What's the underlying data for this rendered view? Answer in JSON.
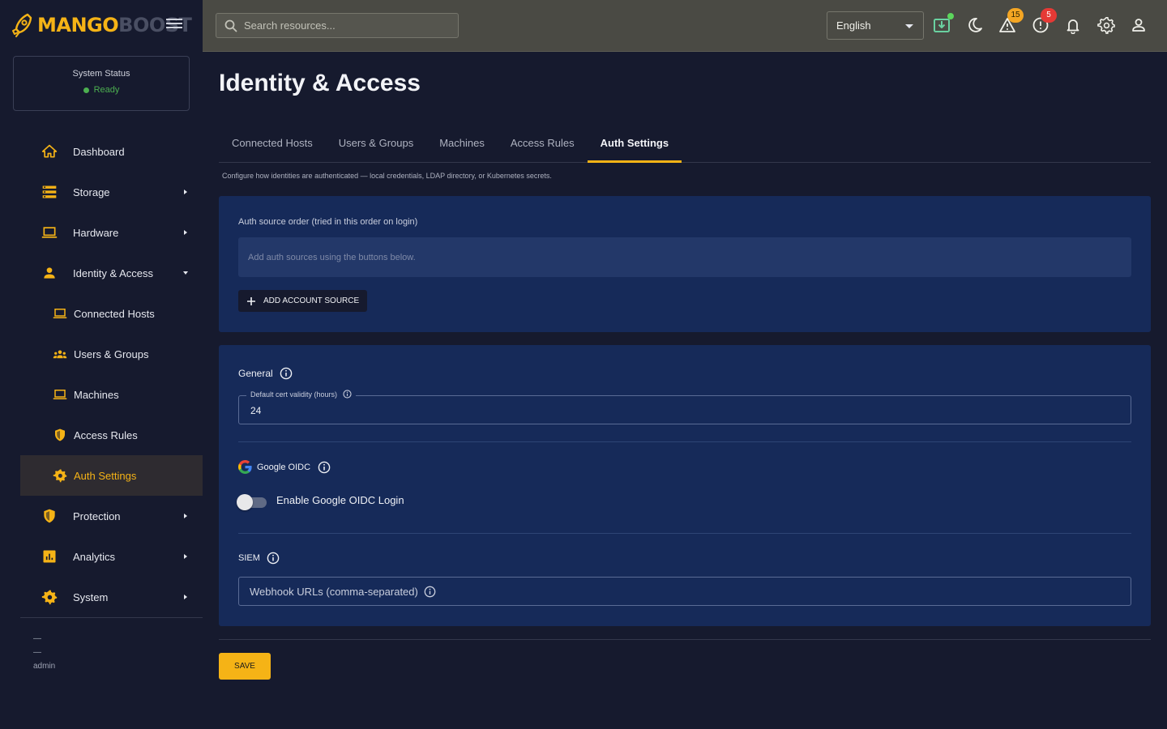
{
  "brand": {
    "part1": "MANGO",
    "part2": "BOOST",
    "accent": "#f5b316"
  },
  "sidebar": {
    "status_title": "System Status",
    "status_value": "Ready",
    "items": [
      {
        "label": "Dashboard",
        "icon": "home-icon"
      },
      {
        "label": "Storage",
        "icon": "storage-icon"
      },
      {
        "label": "Hardware",
        "icon": "laptop-icon"
      },
      {
        "label": "Identity & Access",
        "icon": "person-icon"
      },
      {
        "label": "Connected Hosts",
        "icon": "laptop-icon"
      },
      {
        "label": "Users & Groups",
        "icon": "groups-icon"
      },
      {
        "label": "Machines",
        "icon": "laptop-icon"
      },
      {
        "label": "Access Rules",
        "icon": "shield-icon"
      },
      {
        "label": "Auth Settings",
        "icon": "gear-icon"
      },
      {
        "label": "Protection",
        "icon": "shield-icon"
      },
      {
        "label": "Analytics",
        "icon": "analytics-icon"
      },
      {
        "label": "System",
        "icon": "gear-icon"
      }
    ],
    "footer_line1": "—",
    "footer_line2": "—",
    "footer_user": "admin"
  },
  "topbar": {
    "search_placeholder": "Search resources...",
    "language": "English",
    "warnings_count": "15",
    "errors_count": "5"
  },
  "main": {
    "title": "Identity & Access",
    "tabs": [
      "Connected Hosts",
      "Users & Groups",
      "Machines",
      "Access Rules",
      "Auth Settings"
    ],
    "active_tab": "Auth Settings",
    "tab_description": "Configure how identities are authenticated — local credentials, LDAP directory, or Kubernetes secrets.",
    "auth_order_label": "Auth source order (tried in this order on login)",
    "auth_order_placeholder": "Add auth sources using the buttons below.",
    "add_source_label": "ADD ACCOUNT SOURCE",
    "general": {
      "title": "General",
      "cert_label": "Default cert validity (hours)",
      "cert_value": "24"
    },
    "google": {
      "title": "Google OIDC",
      "toggle_label": "Enable Google OIDC Login",
      "enabled": false
    },
    "siem": {
      "title": "SIEM",
      "webhook_placeholder": "Webhook URLs (comma-separated)"
    },
    "save_label": "SAVE"
  }
}
